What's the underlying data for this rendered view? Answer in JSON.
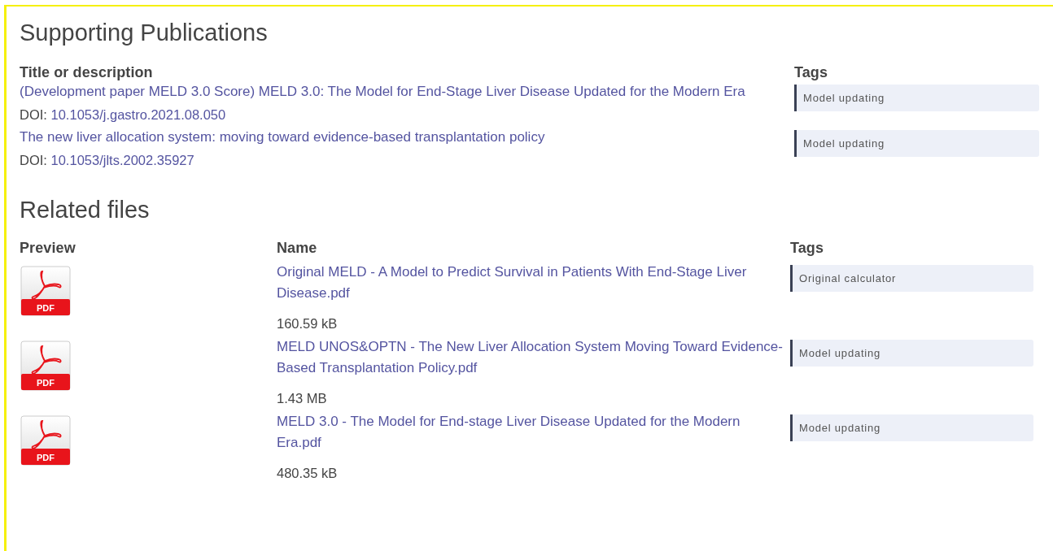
{
  "publications": {
    "heading": "Supporting Publications",
    "columns": [
      "Title or description",
      "Tags"
    ],
    "items": [
      {
        "title": "(Development paper MELD 3.0 Score) MELD 3.0: The Model for End-Stage Liver Disease Updated for the Modern Era",
        "doi_label": "DOI:",
        "doi": "10.1053/j.gastro.2021.08.050",
        "tag": "Model updating"
      },
      {
        "title": "The new liver allocation system: moving toward evidence-based transplantation policy",
        "doi_label": "DOI:",
        "doi": "10.1053/jlts.2002.35927",
        "tag": "Model updating"
      }
    ]
  },
  "files": {
    "heading": "Related files",
    "columns": [
      "Preview",
      "Name",
      "Tags"
    ],
    "items": [
      {
        "icon_label": "PDF",
        "name": "Original MELD - A Model to Predict Survival in Patients With End-Stage Liver Disease.pdf",
        "size": "160.59 kB",
        "tag": "Original calculator"
      },
      {
        "icon_label": "PDF",
        "name": "MELD UNOS&OPTN - The New Liver Allocation System Moving Toward Evidence-Based Transplantation Policy.pdf",
        "size": "1.43 MB",
        "tag": "Model updating"
      },
      {
        "icon_label": "PDF",
        "name": "MELD 3.0 - The Model for End-stage Liver Disease Updated for the Modern Era.pdf",
        "size": "480.35 kB",
        "tag": "Model updating"
      }
    ]
  }
}
